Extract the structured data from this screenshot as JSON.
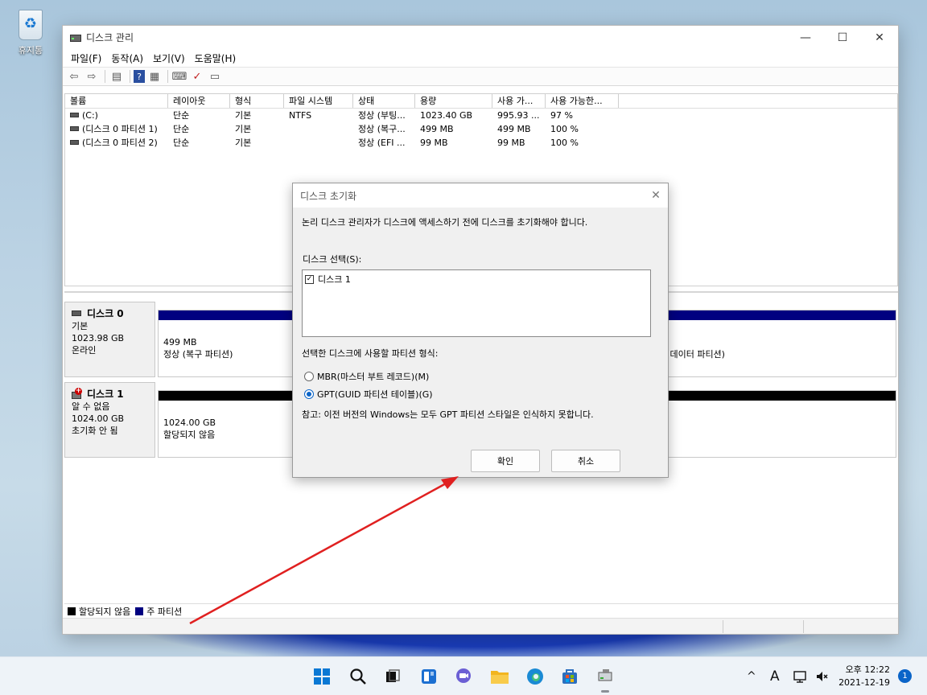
{
  "desktop": {
    "recycle_label": "휴지통"
  },
  "window": {
    "title": "디스크 관리",
    "minimize_glyph": "—",
    "maximize_glyph": "☐",
    "close_glyph": "✕",
    "menu": [
      "파일(F)",
      "동작(A)",
      "보기(V)",
      "도움말(H)"
    ]
  },
  "volume_list": {
    "headers": [
      "볼륨",
      "레이아웃",
      "형식",
      "파일 시스템",
      "상태",
      "용량",
      "사용 가...",
      "사용 가능한..."
    ],
    "rows": [
      [
        "(C:)",
        "단순",
        "기본",
        "NTFS",
        "정상 (부팅...",
        "1023.40 GB",
        "995.93 ...",
        "97 %"
      ],
      [
        "(디스크 0 파티션 1)",
        "단순",
        "기본",
        "",
        "정상 (복구...",
        "499 MB",
        "499 MB",
        "100 %"
      ],
      [
        "(디스크 0 파티션 2)",
        "단순",
        "기본",
        "",
        "정상 (EFI ...",
        "99 MB",
        "99 MB",
        "100 %"
      ]
    ]
  },
  "disks": [
    {
      "name": "디스크 0",
      "type": "기본",
      "size": "1023.98 GB",
      "status": "온라인",
      "partition_size": "499 MB",
      "partition_status": "정상 (복구 파티션)",
      "partition_right_status": "- 데이터 파티션)"
    },
    {
      "name": "디스크 1",
      "type": "알 수 없음",
      "size": "1024.00 GB",
      "status": "초기화 안 됨",
      "partition_size": "1024.00 GB",
      "partition_status": "할당되지 않음"
    }
  ],
  "legend": {
    "unallocated": "할당되지 않음",
    "primary": "주 파티션"
  },
  "dialog": {
    "title": "디스크 초기화",
    "message": "논리 디스크 관리자가 디스크에 액세스하기 전에 디스크를 초기화해야 합니다.",
    "select_label": "디스크 선택(S):",
    "disk_item": "디스크 1",
    "partition_style_label": "선택한 디스크에 사용할 파티션 형식:",
    "mbr_label": "MBR(마스터 부트 레코드)(M)",
    "gpt_label": "GPT(GUID 파티션 테이블)(G)",
    "note": "참고: 이전 버전의 Windows는 모두 GPT 파티션 스타일은 인식하지 못합니다.",
    "ok": "확인",
    "cancel": "취소",
    "selected_style": "GPT"
  },
  "taskbar": {
    "time": "오후 12:22",
    "date": "2021-12-19",
    "notifications": "1",
    "lang": "A",
    "chevron": "^"
  },
  "colors": {
    "primary_partition": "#000080",
    "unallocated": "#000000",
    "annotation": "#e02020"
  }
}
